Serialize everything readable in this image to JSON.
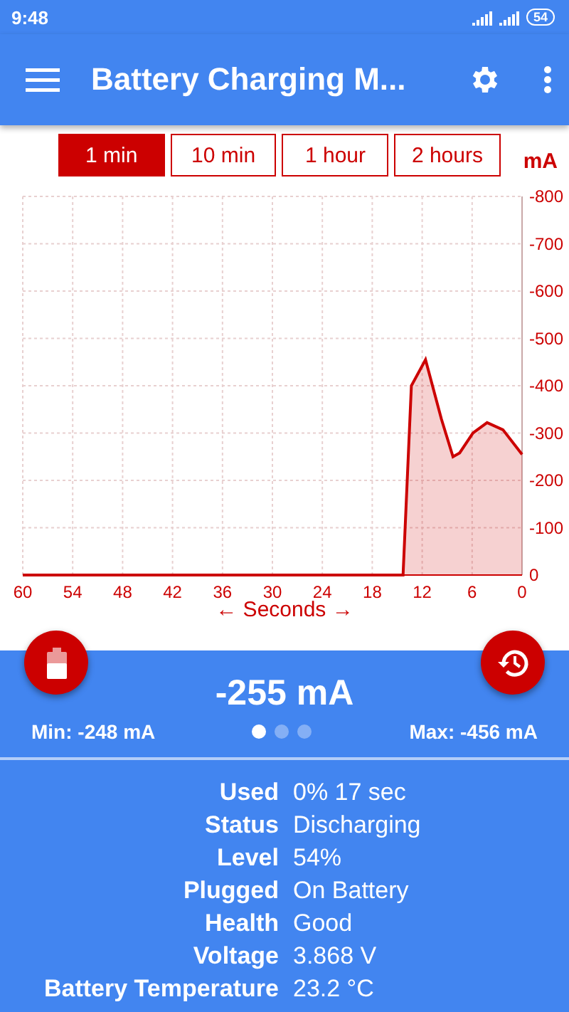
{
  "status_bar": {
    "time": "9:48",
    "battery": "54"
  },
  "toolbar": {
    "title": "Battery Charging M..."
  },
  "ranges": [
    {
      "label": "1 min",
      "selected": true
    },
    {
      "label": "10 min",
      "selected": false
    },
    {
      "label": "1 hour",
      "selected": false
    },
    {
      "label": "2 hours",
      "selected": false
    }
  ],
  "unit": "mA",
  "chart_data": {
    "type": "area",
    "grid": true,
    "xlabel": "← Seconds →",
    "x": [
      60,
      14.3,
      13.3,
      11.6,
      9.7,
      8.3,
      7.5,
      5.9,
      4.2,
      2.3,
      0
    ],
    "series": [
      {
        "color": "#cc0000",
        "values": [
          0,
          0,
          -400,
          -455,
          -330,
          -250,
          -258,
          -300,
          -322,
          -307,
          -255
        ]
      }
    ],
    "xlim": [
      60,
      0
    ],
    "ylim": [
      0,
      -800
    ],
    "xticks": [
      60,
      54,
      48,
      42,
      36,
      30,
      24,
      18,
      12,
      6,
      0
    ],
    "yticks": [
      -800,
      -700,
      -600,
      -500,
      -400,
      -300,
      -200,
      -100,
      0
    ]
  },
  "current": {
    "value": "-255 mA",
    "min": "Min: -248 mA",
    "max": "Max: -456 mA"
  },
  "pages": [
    {
      "selected": true
    },
    {
      "selected": false
    },
    {
      "selected": false
    }
  ],
  "details": [
    {
      "label": "Used",
      "value": "0%  17 sec"
    },
    {
      "label": "Status",
      "value": "Discharging"
    },
    {
      "label": "Level",
      "value": "54%"
    },
    {
      "label": "Plugged",
      "value": "On Battery"
    },
    {
      "label": "Health",
      "value": "Good"
    },
    {
      "label": "Voltage",
      "value": "3.868 V"
    },
    {
      "label": "Battery Temperature",
      "value": "23.2 °C"
    }
  ]
}
